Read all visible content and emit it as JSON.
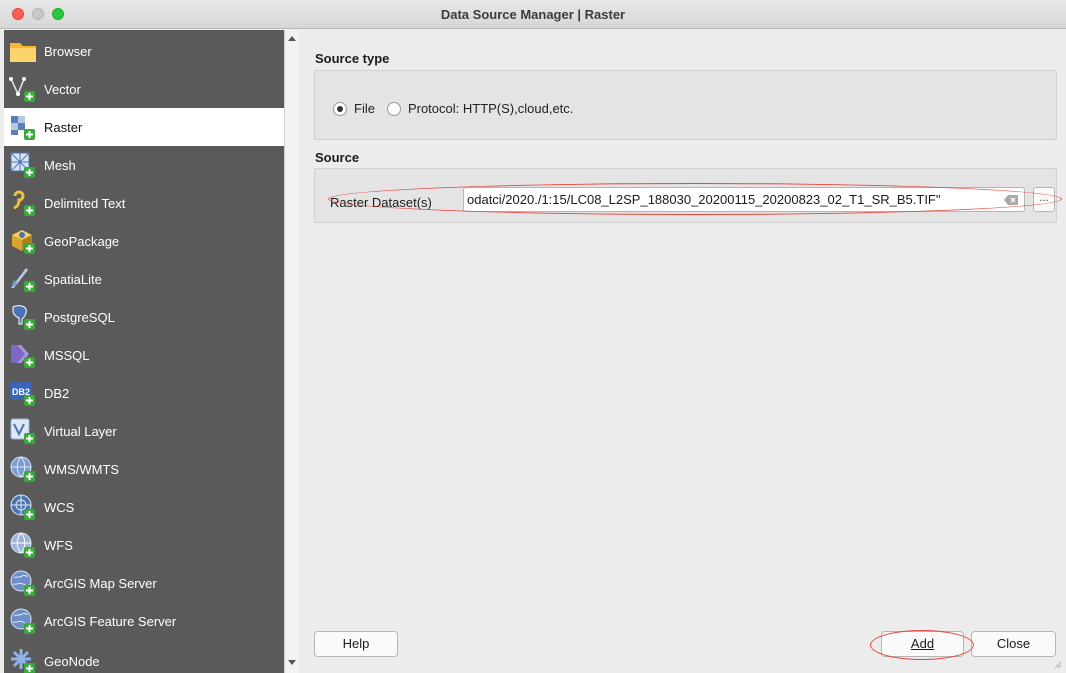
{
  "window": {
    "title": "Data Source Manager | Raster"
  },
  "sidebar": {
    "items": [
      {
        "label": "Browser",
        "icon": "folder-icon"
      },
      {
        "label": "Vector",
        "icon": "vector-icon"
      },
      {
        "label": "Raster",
        "icon": "raster-icon",
        "selected": true
      },
      {
        "label": "Mesh",
        "icon": "mesh-icon"
      },
      {
        "label": "Delimited Text",
        "icon": "delimited-text-icon"
      },
      {
        "label": "GeoPackage",
        "icon": "geopackage-icon"
      },
      {
        "label": "SpatiaLite",
        "icon": "spatialite-icon"
      },
      {
        "label": "PostgreSQL",
        "icon": "postgresql-icon"
      },
      {
        "label": "MSSQL",
        "icon": "mssql-icon"
      },
      {
        "label": "DB2",
        "icon": "db2-icon"
      },
      {
        "label": "Virtual Layer",
        "icon": "virtual-layer-icon"
      },
      {
        "label": "WMS/WMTS",
        "icon": "wms-icon"
      },
      {
        "label": "WCS",
        "icon": "wcs-icon"
      },
      {
        "label": "WFS",
        "icon": "wfs-icon"
      },
      {
        "label": "ArcGIS Map Server",
        "icon": "arcgis-map-server-icon"
      },
      {
        "label": "ArcGIS Feature Server",
        "icon": "arcgis-feature-server-icon"
      },
      {
        "label": "GeoNode",
        "icon": "geonode-icon"
      }
    ]
  },
  "source_type": {
    "title": "Source type",
    "options": [
      {
        "label": "File",
        "checked": true
      },
      {
        "label": "Protocol: HTTP(S),cloud,etc.",
        "checked": false
      }
    ]
  },
  "source": {
    "title": "Source",
    "dataset_label": "Raster Dataset(s)",
    "dataset_value": "odatci/2020./1:15/LC08_L2SP_188030_20200115_20200823_02_T1_SR_B5.TIF\"",
    "browse_label": "..."
  },
  "footer": {
    "help_label": "Help",
    "add_label": "Add",
    "close_label": "Close"
  },
  "colors": {
    "sidebar_bg": "#5a5a5a",
    "highlight": "#e4473f"
  }
}
